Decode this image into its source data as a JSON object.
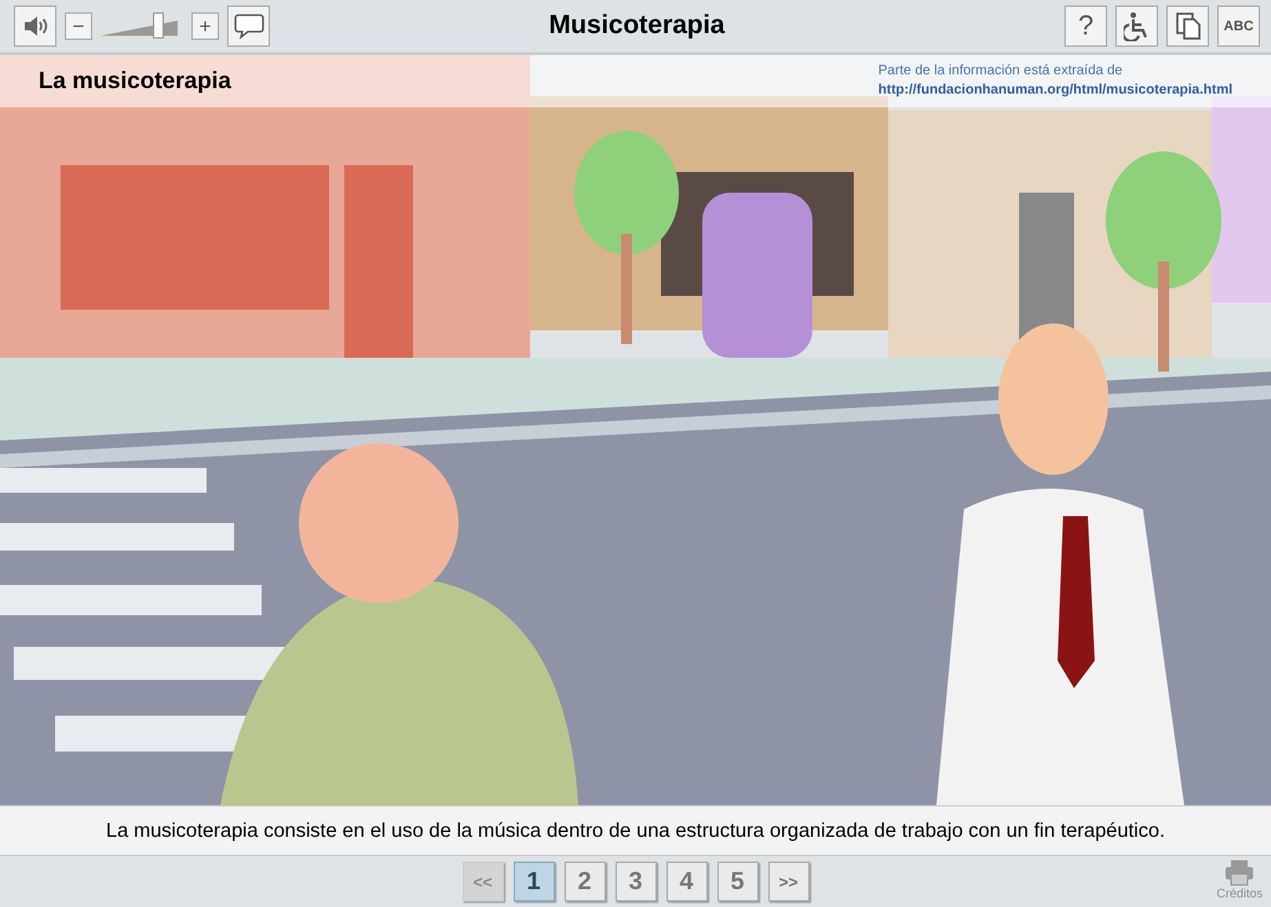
{
  "toolbar": {
    "title": "Musicoterapia",
    "volume": {
      "minus": "−",
      "plus": "+",
      "level": 0.75
    },
    "help": "?",
    "text_button": "ABC"
  },
  "scene": {
    "heading": "La musicoterapia",
    "source_note": "Parte de la información está extraída de",
    "source_link": "http://fundacionhanuman.org/html/musicoterapia.html"
  },
  "caption": "La musicoterapia consiste en el uso de la música dentro de una estructura organizada de trabajo con un fin terapéutico.",
  "pagination": {
    "prev": {
      "label": "<<",
      "disabled": true
    },
    "next": {
      "label": ">>",
      "disabled": false
    },
    "pages": [
      {
        "label": "1",
        "selected": true
      },
      {
        "label": "2",
        "selected": false
      },
      {
        "label": "3",
        "selected": false
      },
      {
        "label": "4",
        "selected": false
      },
      {
        "label": "5",
        "selected": false
      }
    ]
  },
  "credits": "Créditos"
}
